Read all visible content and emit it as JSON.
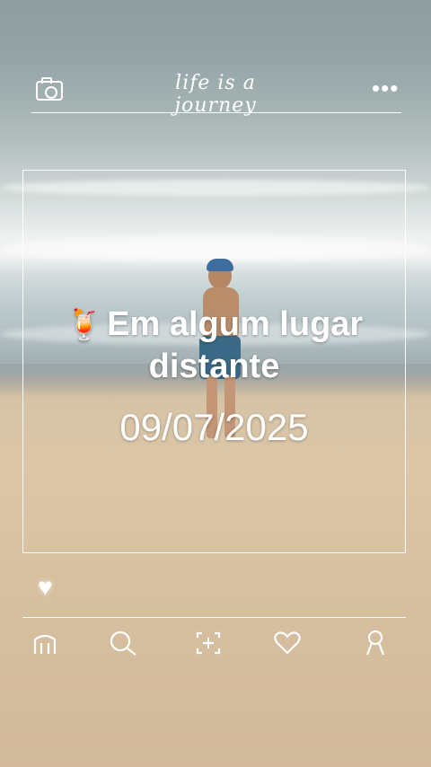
{
  "header": {
    "camera_icon": "camera-icon",
    "script_title": "life is a journey",
    "more_icon": "more-dots-icon"
  },
  "card": {
    "emoji": "🍹",
    "caption_line1": "Em algum lugar",
    "caption_line2": "distante",
    "date": "09/07/2025"
  },
  "actions": {
    "like_icon": "heart-filled-icon"
  },
  "bottom_nav": [
    {
      "icon": "home-icon"
    },
    {
      "icon": "search-icon"
    },
    {
      "icon": "add-icon"
    },
    {
      "icon": "heart-outline-icon"
    },
    {
      "icon": "profile-icon"
    }
  ],
  "colors": {
    "overlay": "#ffffff",
    "sea": "#9eacaf",
    "sand": "#d7c0a0"
  }
}
